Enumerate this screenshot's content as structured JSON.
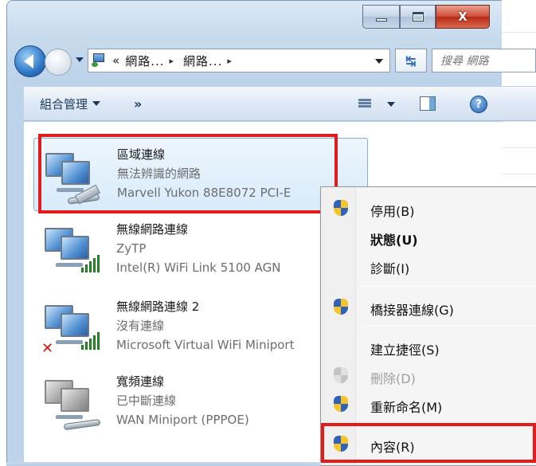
{
  "window": {
    "caption": {
      "minimize": "—",
      "maximize": "□",
      "close": "X"
    }
  },
  "navbar": {
    "breadcrumb_prefix": "«",
    "crumbs": [
      "網路...",
      "網路..."
    ],
    "crumb_separator": "▸",
    "search_placeholder": "搜尋 網路"
  },
  "cmdbar": {
    "organize": "組合管理",
    "more": "»",
    "help": "?"
  },
  "connections": [
    {
      "name": "區域連線",
      "status": "無法辨識的網路",
      "device": "Marvell Yukon 88E8072 PCI-E",
      "icon": "wired-network-icon",
      "state": "connected",
      "selected": true
    },
    {
      "name": "無線網路連線",
      "status": "ZyTP",
      "device": "Intel(R) WiFi Link 5100 AGN",
      "icon": "wireless-network-icon",
      "state": "connected",
      "selected": false
    },
    {
      "name": "無線網路連線 2",
      "status": "沒有連線",
      "device": "Microsoft Virtual WiFi Miniport",
      "icon": "wireless-network-icon",
      "state": "disconnected",
      "selected": false
    },
    {
      "name": "寬頻連線",
      "status": "已中斷連線",
      "device": "WAN Miniport (PPPOE)",
      "icon": "broadband-icon",
      "state": "disconnected",
      "selected": false
    }
  ],
  "context_menu": {
    "items": [
      {
        "label": "停用(B)",
        "shield": true,
        "bold": false,
        "disabled": false
      },
      {
        "label": "狀態(U)",
        "shield": false,
        "bold": true,
        "disabled": false
      },
      {
        "label": "診斷(I)",
        "shield": false,
        "bold": false,
        "disabled": false
      },
      {
        "label": "橋接器連線(G)",
        "shield": true,
        "bold": false,
        "disabled": false
      },
      {
        "label": "建立捷徑(S)",
        "shield": false,
        "bold": false,
        "disabled": false
      },
      {
        "label": "刪除(D)",
        "shield": true,
        "bold": false,
        "disabled": true
      },
      {
        "label": "重新命名(M)",
        "shield": true,
        "bold": false,
        "disabled": false
      },
      {
        "label": "內容(R)",
        "shield": true,
        "bold": false,
        "disabled": false
      }
    ]
  },
  "colors": {
    "highlight_box": "#e21b1b",
    "selection_bg": "#d7ebfb",
    "menu_bg": "#f5f5f5"
  }
}
